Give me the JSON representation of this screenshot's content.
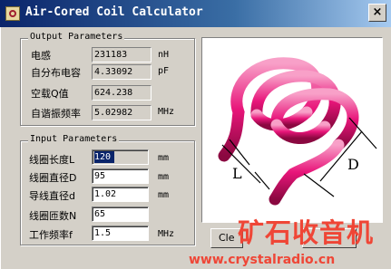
{
  "window": {
    "title": "Air-Cored Coil Calculator",
    "close_glyph": "×"
  },
  "output": {
    "group_title": "Output Parameters",
    "rows": [
      {
        "label": "电感",
        "value": "231183",
        "unit": "nH"
      },
      {
        "label": "自分布电容",
        "value": "4.33092",
        "unit": "pF"
      },
      {
        "label": "空载Q值",
        "value": "624.238",
        "unit": ""
      },
      {
        "label": "自谐振频率",
        "value": "5.02982",
        "unit": "MHz"
      }
    ]
  },
  "input": {
    "group_title": "Input Parameters",
    "rows": [
      {
        "label": "线圈长度L",
        "value": "120",
        "unit": "mm",
        "selected": true
      },
      {
        "label": "线圈直径D",
        "value": "95",
        "unit": "mm"
      },
      {
        "label": "导线直径d",
        "value": "1.02",
        "unit": "mm"
      },
      {
        "label": "线圈匝数N",
        "value": "65",
        "unit": ""
      },
      {
        "label": "工作频率f",
        "value": "1.5",
        "unit": "MHz"
      }
    ]
  },
  "diagram": {
    "label_L": "L",
    "label_D": "D",
    "coil_color": "#e8157a"
  },
  "buttons": {
    "clear_label": "Cle"
  },
  "watermark": {
    "text_cn": "矿石收音机",
    "url": "www.crystalradio.cn",
    "color": "#ef4636"
  },
  "icons": {
    "app": "coil-app-icon",
    "close": "close-icon"
  }
}
